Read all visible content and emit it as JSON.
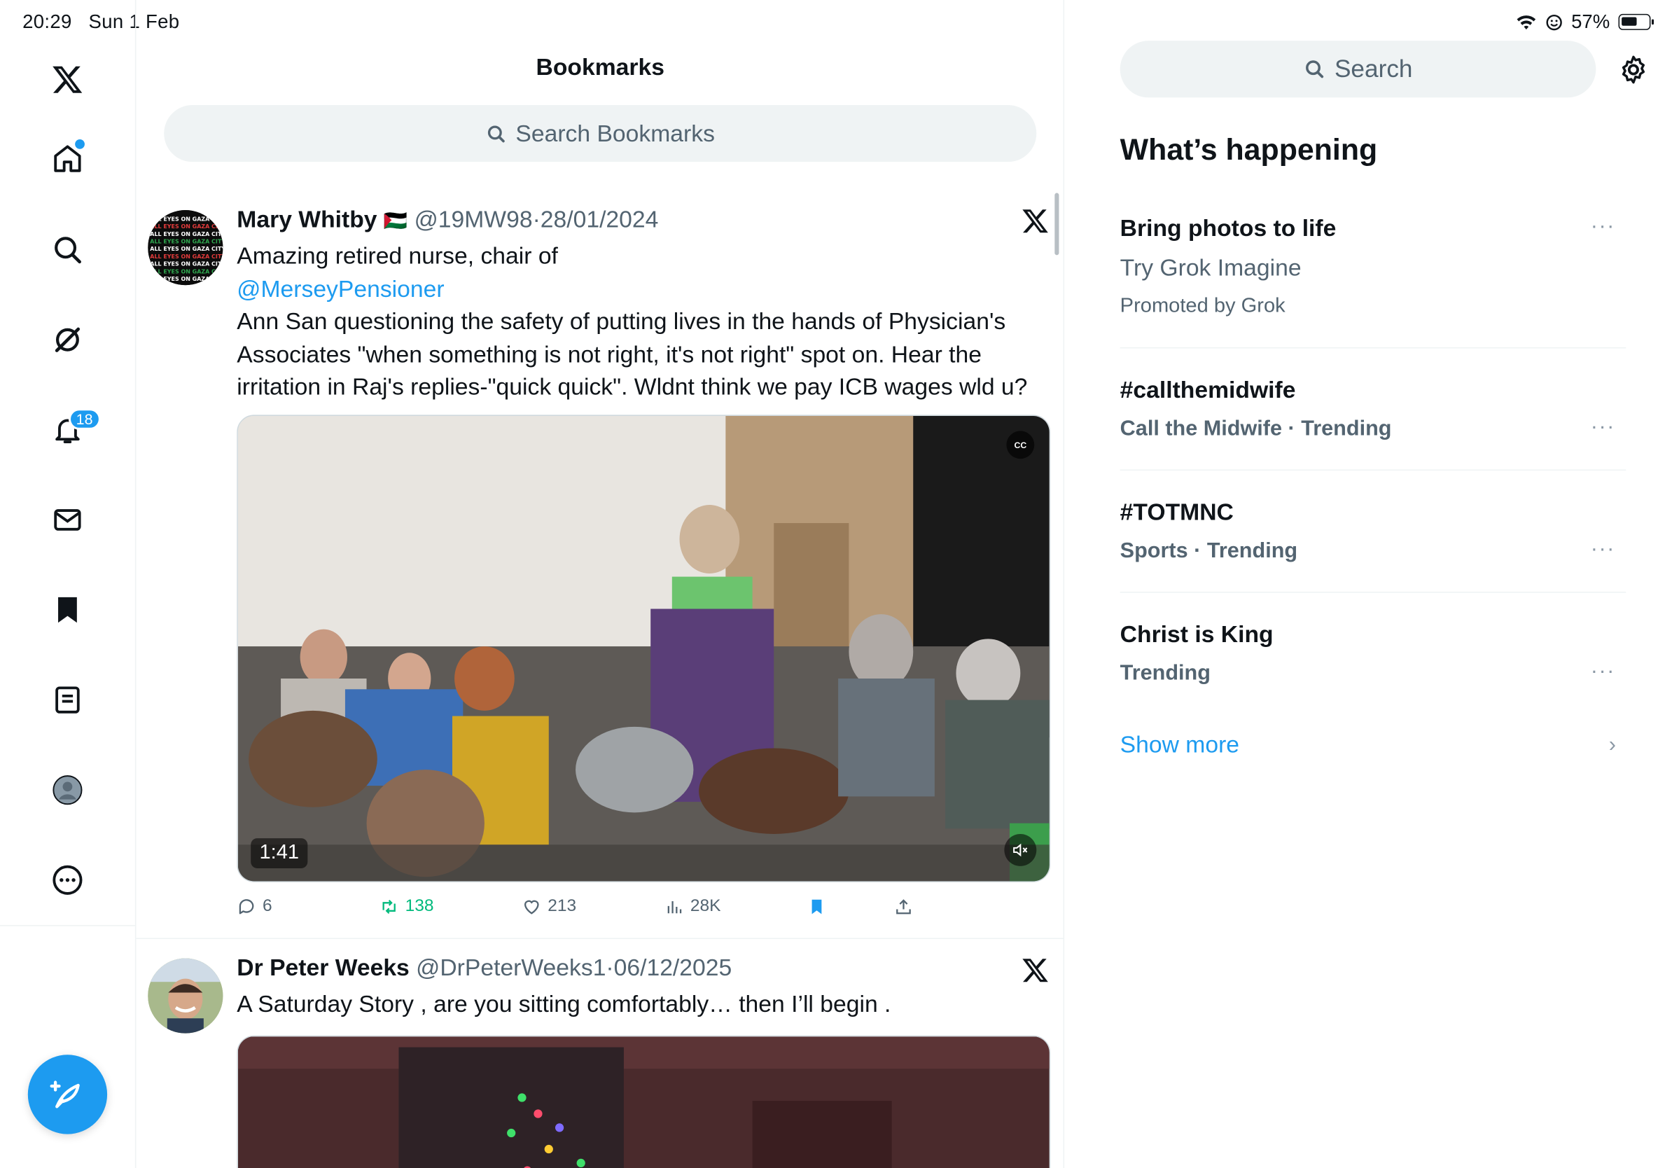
{
  "status": {
    "time": "20:29",
    "date": "Sun 1 Feb",
    "battery": "57%"
  },
  "nav": {
    "notifications_badge": "18"
  },
  "main": {
    "title": "Bookmarks",
    "search_placeholder": "Search Bookmarks",
    "tweets": [
      {
        "name": "Mary Whitby",
        "flag": "🇵🇸",
        "handle": "@19MW98",
        "sep": "·",
        "date": "28/01/2024",
        "line1": "Amazing retired nurse, chair of",
        "mention": "@MerseyPensioner",
        "line2": " Ann San questioning the safety of putting lives in the hands of Physician's Associates \"when something is not right, it's not right\" spot on. Hear the irritation in Raj's replies-\"quick quick\". Wldnt think we pay ICB wages wld u?",
        "video_duration": "1:41",
        "cc": "CC",
        "replies": "6",
        "retweets": "138",
        "likes": "213",
        "views": "28K"
      },
      {
        "name": "Dr Peter Weeks",
        "handle": "@DrPeterWeeks1",
        "sep": "·",
        "date": "06/12/2025",
        "text": "A Saturday Story , are you sitting comfortably… then I’ll begin ."
      }
    ]
  },
  "right": {
    "search_placeholder": "Search",
    "section_title": "What’s happening",
    "trends": [
      {
        "title": "Bring photos to life",
        "sub": "Try Grok Imagine",
        "meta": "Promoted by Grok"
      },
      {
        "title": "#callthemidwife",
        "meta": "Call the Midwife · Trending"
      },
      {
        "title": "#TOTMNC",
        "meta": "Sports · Trending"
      },
      {
        "title": "Christ is King",
        "meta": "Trending"
      }
    ],
    "more_symbol": "···",
    "show_more": "Show more"
  },
  "colors": {
    "accent": "#1d9bf0",
    "retweet": "#00ba7c",
    "muted": "#536471"
  }
}
